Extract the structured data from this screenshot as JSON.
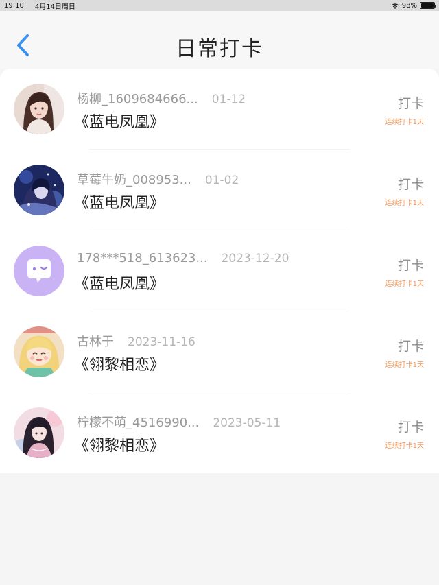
{
  "status": {
    "time": "19:10",
    "date": "4月14日周日",
    "battery": "98%",
    "battery_level": 0.98,
    "wifi_icon": "wifi-icon"
  },
  "header": {
    "back_icon": "chevron-left-icon",
    "title": "日常打卡",
    "accent": "#3a93f0"
  },
  "entries": [
    {
      "username": "杨柳_1609684666...",
      "date": "01-12",
      "book": "《蓝电凤凰》",
      "action": "打卡",
      "streak": "连续打卡1天",
      "avatar": "user-photo-avatar"
    },
    {
      "username": "草莓牛奶_008953...",
      "date": "01-02",
      "book": "《蓝电凤凰》",
      "action": "打卡",
      "streak": "连续打卡1天",
      "avatar": "anime-blue-avatar"
    },
    {
      "username": "178***518_613623...",
      "date": "2023-12-20",
      "book": "《蓝电凤凰》",
      "action": "打卡",
      "streak": "连续打卡1天",
      "avatar": "chat-bubble-avatar"
    },
    {
      "username": "古林于",
      "date": "2023-11-16",
      "book": "《翎黎相恋》",
      "action": "打卡",
      "streak": "连续打卡1天",
      "avatar": "anime-blonde-avatar"
    },
    {
      "username": "柠檬不萌_4516990...",
      "date": "2023-05-11",
      "book": "《翎黎相恋》",
      "action": "打卡",
      "streak": "连续打卡1天",
      "avatar": "anime-pink-avatar"
    }
  ],
  "colors": {
    "streak": "#f39a5d",
    "avatar_placeholder": "#c9b3f5"
  }
}
